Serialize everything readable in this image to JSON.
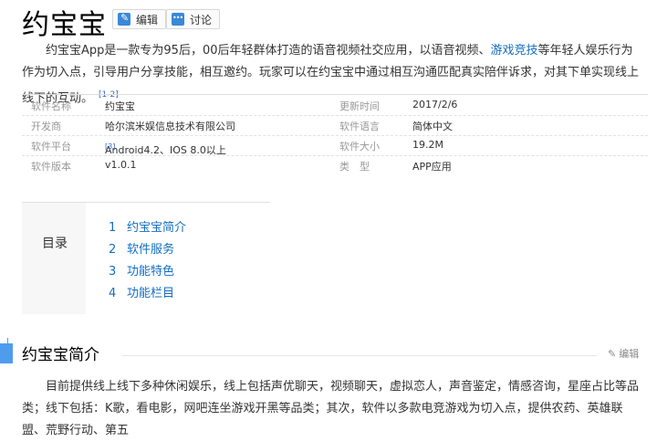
{
  "header": {
    "title": "约宝宝",
    "edit_label": "编辑",
    "discuss_label": "讨论"
  },
  "intro": {
    "before_link": "约宝宝App是一款专为95后，00后年轻群体打造的语音视频社交应用，以语音视频、",
    "link_text": "游戏竞技",
    "after_link": "等年轻人娱乐行为作为切入点，引导用户分享技能，相互邀约。玩家可以在约宝宝中通过相互沟通匹配真实陪伴诉求，对其下单实现线上线下的互动。",
    "ref": "[1-2]"
  },
  "basic_info": {
    "rows": [
      {
        "k1": "软件名称",
        "v1": "约宝宝",
        "k2": "更新时间",
        "v2": "2017/2/6"
      },
      {
        "k1": "开发商",
        "v1": "哈尔滨米娱信息技术有限公司",
        "k2": "软件语言",
        "v2": "简体中文"
      },
      {
        "k1": "软件平台",
        "v1": "Android4.2、IOS 8.0以上",
        "v1_ref": "[3]",
        "k2": "软件大小",
        "v2": "19.2M"
      },
      {
        "k1": "软件版本",
        "v1": "v1.0.1",
        "k2": "类　型",
        "v2": "APP应用"
      }
    ]
  },
  "toc": {
    "title": "目录",
    "items": [
      {
        "num": "1",
        "label": "约宝宝简介"
      },
      {
        "num": "2",
        "label": "软件服务"
      },
      {
        "num": "3",
        "label": "功能特色"
      },
      {
        "num": "4",
        "label": "功能栏目"
      }
    ]
  },
  "section": {
    "title": "约宝宝简介",
    "edit_label": "编辑",
    "paragraph": "目前提供线上线下多种休闲娱乐，线上包括声优聊天，视频聊天，虚拟恋人，声音鉴定，情感咨询，星座占比等品类；线下包括：K歌，看电影，网吧连坐游戏开黑等品类；其次，软件以多款电竞游戏为切入点，提供农药、英雄联盟、荒野行动、第五"
  },
  "colors": {
    "link": "#136ec2",
    "accent": "#4f9cee",
    "button_icon": "#3b88d8"
  },
  "icons": {
    "edit": "pencil-icon",
    "discuss": "speech-bubble-icon"
  }
}
